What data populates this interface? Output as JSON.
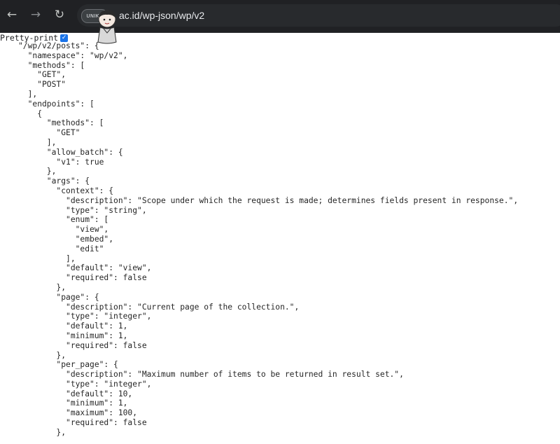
{
  "browser": {
    "site_chip": "UNIKA",
    "url": "ac.id/wp-json/wp/v2",
    "back_icon": "arrow-left-icon",
    "forward_icon": "arrow-right-icon",
    "reload_icon": "reload-icon"
  },
  "viewer": {
    "pretty_print_label": "Pretty-print",
    "pretty_print_checked": true
  },
  "json_lines": [
    "\"/wp/v2/posts\": {",
    "  \"namespace\": \"wp/v2\",",
    "  \"methods\": [",
    "    \"GET\",",
    "    \"POST\"",
    "  ],",
    "  \"endpoints\": [",
    "    {",
    "      \"methods\": [",
    "        \"GET\"",
    "      ],",
    "      \"allow_batch\": {",
    "        \"v1\": true",
    "      },",
    "      \"args\": {",
    "        \"context\": {",
    "          \"description\": \"Scope under which the request is made; determines fields present in response.\",",
    "          \"type\": \"string\",",
    "          \"enum\": [",
    "            \"view\",",
    "            \"embed\",",
    "            \"edit\"",
    "          ],",
    "          \"default\": \"view\",",
    "          \"required\": false",
    "        },",
    "        \"page\": {",
    "          \"description\": \"Current page of the collection.\",",
    "          \"type\": \"integer\",",
    "          \"default\": 1,",
    "          \"minimum\": 1,",
    "          \"required\": false",
    "        },",
    "        \"per_page\": {",
    "          \"description\": \"Maximum number of items to be returned in result set.\",",
    "          \"type\": \"integer\",",
    "          \"default\": 10,",
    "          \"minimum\": 1,",
    "          \"maximum\": 100,",
    "          \"required\": false",
    "        },"
  ]
}
